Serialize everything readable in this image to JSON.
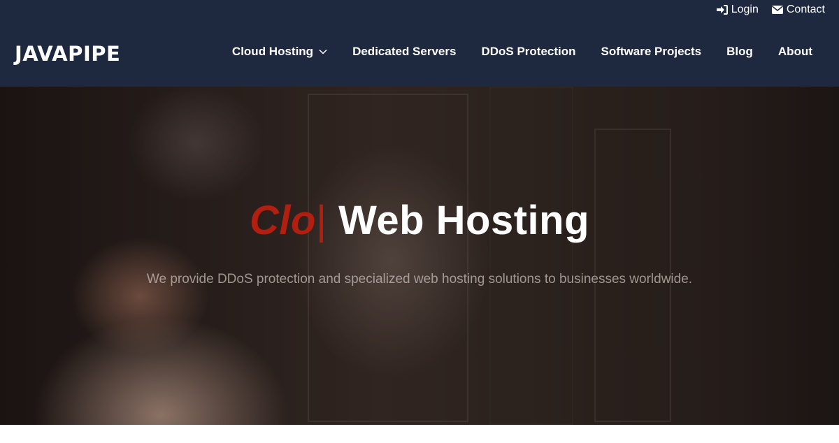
{
  "topbar": {
    "login": {
      "label": "Login",
      "icon": "sign-in-icon"
    },
    "contact": {
      "label": "Contact",
      "icon": "envelope-icon"
    }
  },
  "brand": {
    "logo_text": "JAVAPIPE"
  },
  "nav": {
    "items": [
      {
        "label": "Cloud Hosting",
        "has_dropdown": true
      },
      {
        "label": "Dedicated Servers"
      },
      {
        "label": "DDoS Protection"
      },
      {
        "label": "Software Projects"
      },
      {
        "label": "Blog"
      },
      {
        "label": "About"
      }
    ]
  },
  "hero": {
    "headline_typed": "Clo",
    "headline_cursor": "|",
    "headline_rest": "Web Hosting",
    "subheadline": "We provide DDoS protection and specialized web hosting solutions to businesses worldwide."
  },
  "colors": {
    "header_bg": "#1e2940",
    "accent_red": "#b01f10",
    "text_white": "#ffffff"
  }
}
